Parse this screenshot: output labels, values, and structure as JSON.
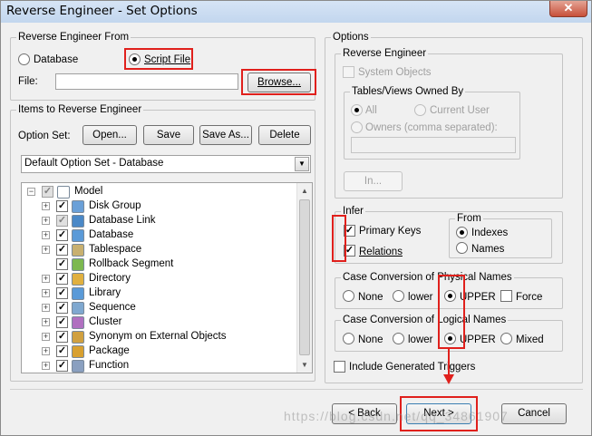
{
  "window": {
    "title": "Reverse Engineer - Set Options",
    "close_glyph": "✕"
  },
  "source": {
    "legend": "Reverse Engineer From",
    "database_label": "Database",
    "script_label": "Script File",
    "selected": "Script File",
    "file_label": "File:",
    "file_value": "",
    "browse_label": "Browse..."
  },
  "items": {
    "legend": "Items to Reverse Engineer",
    "option_set_label": "Option Set:",
    "open_label": "Open...",
    "save_label": "Save",
    "save_as_label": "Save As...",
    "delete_label": "Delete",
    "selected_option_set": "Default Option Set - Database",
    "tree": [
      {
        "label": "Model",
        "icon": "model-icon",
        "checked": "partial",
        "expand": true,
        "level": 0
      },
      {
        "label": "Disk Group",
        "icon": "disk-group-icon",
        "checked": true,
        "expand": true,
        "level": 1
      },
      {
        "label": "Database Link",
        "icon": "database-link-icon",
        "checked": "partial",
        "expand": true,
        "level": 1
      },
      {
        "label": "Database",
        "icon": "database-icon",
        "checked": true,
        "expand": true,
        "level": 1
      },
      {
        "label": "Tablespace",
        "icon": "tablespace-icon",
        "checked": true,
        "expand": true,
        "level": 1
      },
      {
        "label": "Rollback Segment",
        "icon": "rollback-segment-icon",
        "checked": true,
        "expand": false,
        "level": 1
      },
      {
        "label": "Directory",
        "icon": "directory-icon",
        "checked": true,
        "expand": true,
        "level": 1
      },
      {
        "label": "Library",
        "icon": "library-icon",
        "checked": true,
        "expand": true,
        "level": 1
      },
      {
        "label": "Sequence",
        "icon": "sequence-icon",
        "checked": true,
        "expand": true,
        "level": 1
      },
      {
        "label": "Cluster",
        "icon": "cluster-icon",
        "checked": true,
        "expand": true,
        "level": 1
      },
      {
        "label": "Synonym on External Objects",
        "icon": "synonym-icon",
        "checked": true,
        "expand": true,
        "level": 1
      },
      {
        "label": "Package",
        "icon": "package-icon",
        "checked": true,
        "expand": true,
        "level": 1
      },
      {
        "label": "Function",
        "icon": "function-icon",
        "checked": true,
        "expand": true,
        "level": 1
      }
    ]
  },
  "options": {
    "legend": "Options",
    "reverse": {
      "legend": "Reverse Engineer",
      "system_objects_label": "System Objects",
      "owned_legend": "Tables/Views Owned By",
      "all_label": "All",
      "current_user_label": "Current User",
      "owners_label": "Owners (comma separated):",
      "owners_value": "",
      "in_label": "In..."
    },
    "infer": {
      "legend": "Infer",
      "primary_keys_label": "Primary Keys",
      "relations_label": "Relations",
      "from_legend": "From",
      "indexes_label": "Indexes",
      "names_label": "Names",
      "from_selected": "Indexes"
    },
    "physical": {
      "legend": "Case Conversion of Physical Names",
      "none_label": "None",
      "lower_label": "lower",
      "upper_label": "UPPER",
      "force_label": "Force",
      "selected": "UPPER"
    },
    "logical": {
      "legend": "Case Conversion of Logical Names",
      "none_label": "None",
      "lower_label": "lower",
      "upper_label": "UPPER",
      "mixed_label": "Mixed",
      "selected": "UPPER"
    },
    "include_triggers_label": "Include Generated Triggers"
  },
  "footer": {
    "back_label": "< Back",
    "next_label": "Next >",
    "cancel_label": "Cancel",
    "watermark": "https://blog.csdn.net/qq_34861907"
  },
  "colors": {
    "annotation": "#e0201c",
    "titlebar": "#c9dbf0",
    "window_bg": "#f0f0f0"
  }
}
